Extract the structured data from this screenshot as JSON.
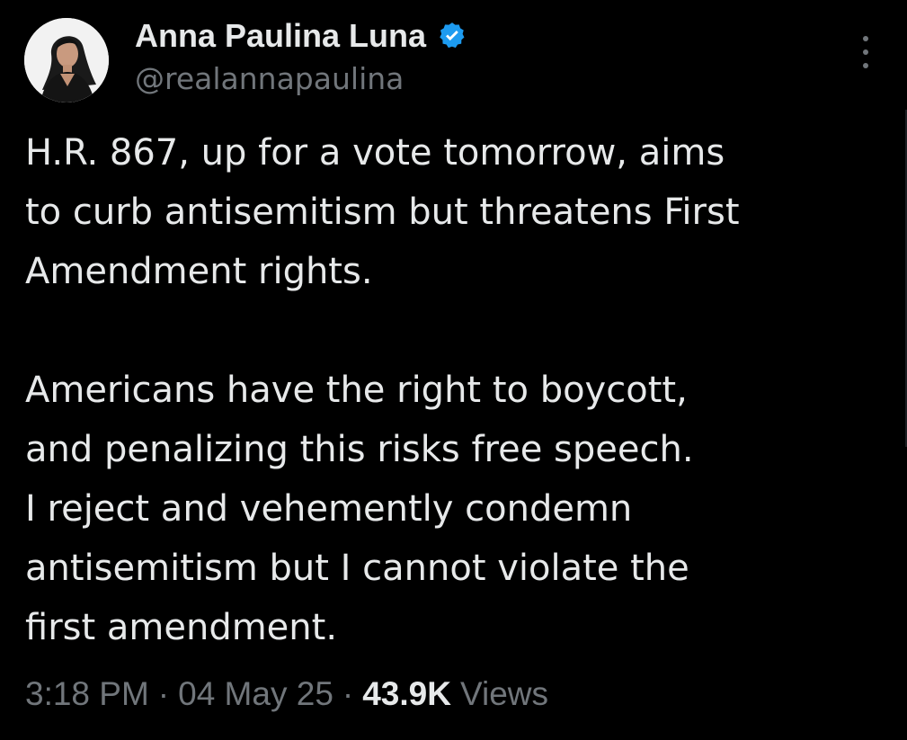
{
  "author": {
    "display_name": "Anna Paulina Luna",
    "handle": "@realannapaulina",
    "verified_icon": "verified-badge-icon",
    "verified_color": "#1d9bf0"
  },
  "tweet": {
    "paragraph1": [
      "H.R. 867, up for a vote tomorrow, aims",
      "to curb antisemitism but threatens First",
      "Amendment rights."
    ],
    "paragraph2": [
      "Americans have the right to boycott,",
      "and penalizing this risks free speech.",
      "I reject and vehemently condemn",
      "antisemitism but I cannot violate the",
      "first amendment."
    ]
  },
  "meta": {
    "time": "3:18 PM",
    "separator": "·",
    "date": "04 May 25",
    "views_count": "43.9K",
    "views_label": "Views"
  },
  "colors": {
    "background": "#000000",
    "primary_text": "#e7e9ea",
    "secondary_text": "#71767b"
  },
  "icons": {
    "more": "more-options-icon"
  }
}
